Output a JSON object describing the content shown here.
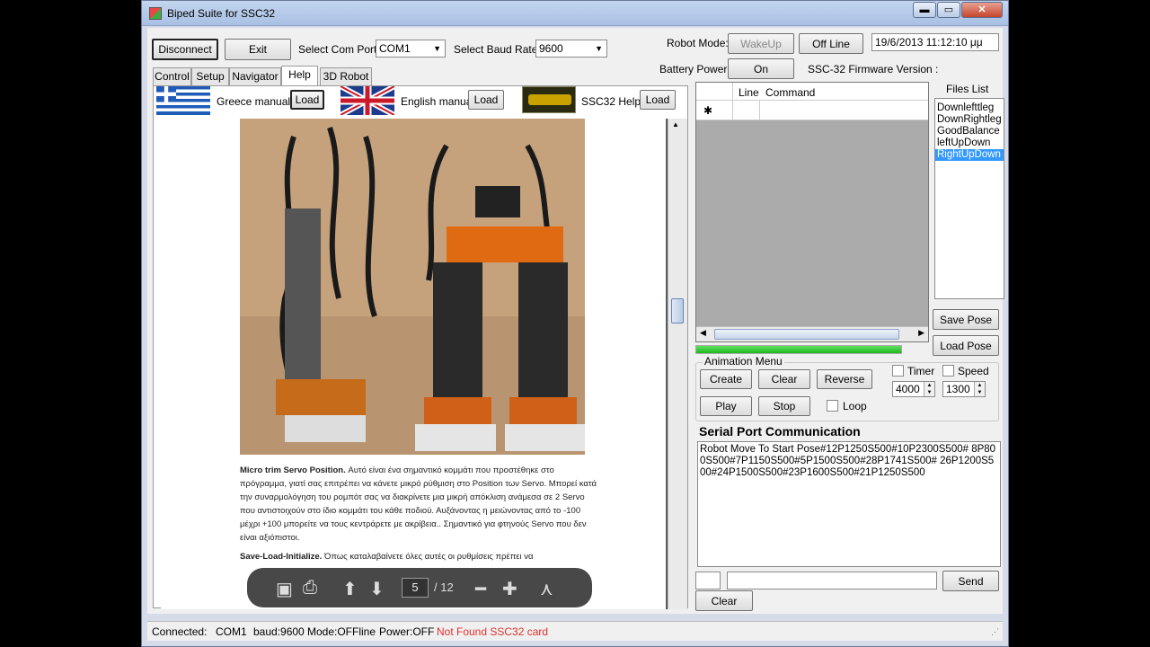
{
  "window": {
    "title": "Biped Suite for SSC32",
    "min": "▬",
    "max": "▭",
    "close": "✕"
  },
  "toolbar": {
    "disconnect": "Disconnect",
    "exit": "Exit",
    "com_port_label": "Select Com Port:",
    "com_port_value": "COM1",
    "baud_label": "Select Baud Rate:",
    "baud_value": "9600",
    "robot_mode_label": "Robot Mode:",
    "wakeup": "WakeUp",
    "offline": "Off Line",
    "datetime": "19/6/2013 11:12:10 μμ",
    "battery_label": "Battery Power:",
    "battery_on": "On",
    "firmware_label": "SSC-32 Firmware Version :"
  },
  "tabs": [
    "Control",
    "Setup",
    "Navigator",
    "Help",
    "3D Robot"
  ],
  "help": {
    "greece_manual": "Greece manual",
    "english_manual": "English manual",
    "ssc32_help": "SSC32 Help",
    "load": "Load",
    "doc_p1_title": "Micro trim Servo Position.",
    "doc_p1_body": " Αυτό είναι ένα σημαντικό κομμάτι που προστέθηκε στο πρόγραμμα, γιατί σας επιτρέπει να κάνετε μικρό ρύθμιση στο Position των Servo. Μπορεί κατά την συναρμολόγηση του ρομπότ σας να διακρίνετε μια μικρή απόκλιση ανάμεσα σε 2 Servo που αντιστοιχούν στο ίδιο κομμάτι του κάθε ποδιού. Αυξάνοντας η μειώνοντας από το -100 μέχρι +100 μπορείτε να τους κεντράρετε με ακρίβεια.. Σημαντικό για φτηνούς Servo που δεν είναι αξιόπιστοι.",
    "doc_p2_title": "Save-Load-Initialize.",
    "doc_p2_body": " Όπως καταλαβαίνετε όλες αυτές οι ρυθμίσεις πρέπει να",
    "pdf_page": "5",
    "pdf_total": "/ 12"
  },
  "command_grid": {
    "col_line": "Line",
    "col_command": "Command",
    "new_row": "✱"
  },
  "progress": {
    "value": 1.0
  },
  "files": {
    "label": "Files List",
    "items": [
      "Downlefttleg",
      "DownRightleg",
      "GoodBalance",
      "leftUpDown",
      "RightUpDown"
    ],
    "selected": 4,
    "save_pose": "Save Pose",
    "load_pose": "Load Pose"
  },
  "animation": {
    "label": "Animation Menu",
    "create": "Create",
    "clear": "Clear",
    "reverse": "Reverse",
    "play": "Play",
    "stop": "Stop",
    "loop": "Loop",
    "timer": "Timer",
    "speed": "Speed",
    "timer_value": "4000",
    "speed_value": "1300"
  },
  "serial": {
    "label": "Serial Port Communication",
    "log": "Robot Move To Start Pose#12P1250S500#10P2300S500# 8P800S500#7P1150S500#5P1500S500#28P1741S500# 26P1200S500#24P1500S500#23P1600S500#21P1250S500",
    "send": "Send",
    "clear": "Clear"
  },
  "status": {
    "connected": "Connected:",
    "port": "COM1",
    "baud": "baud:9600",
    "mode": "Mode:OFFline",
    "power": "Power:OFF",
    "error": "Not Found SSC32 card",
    "error_color": "#e0302a"
  }
}
